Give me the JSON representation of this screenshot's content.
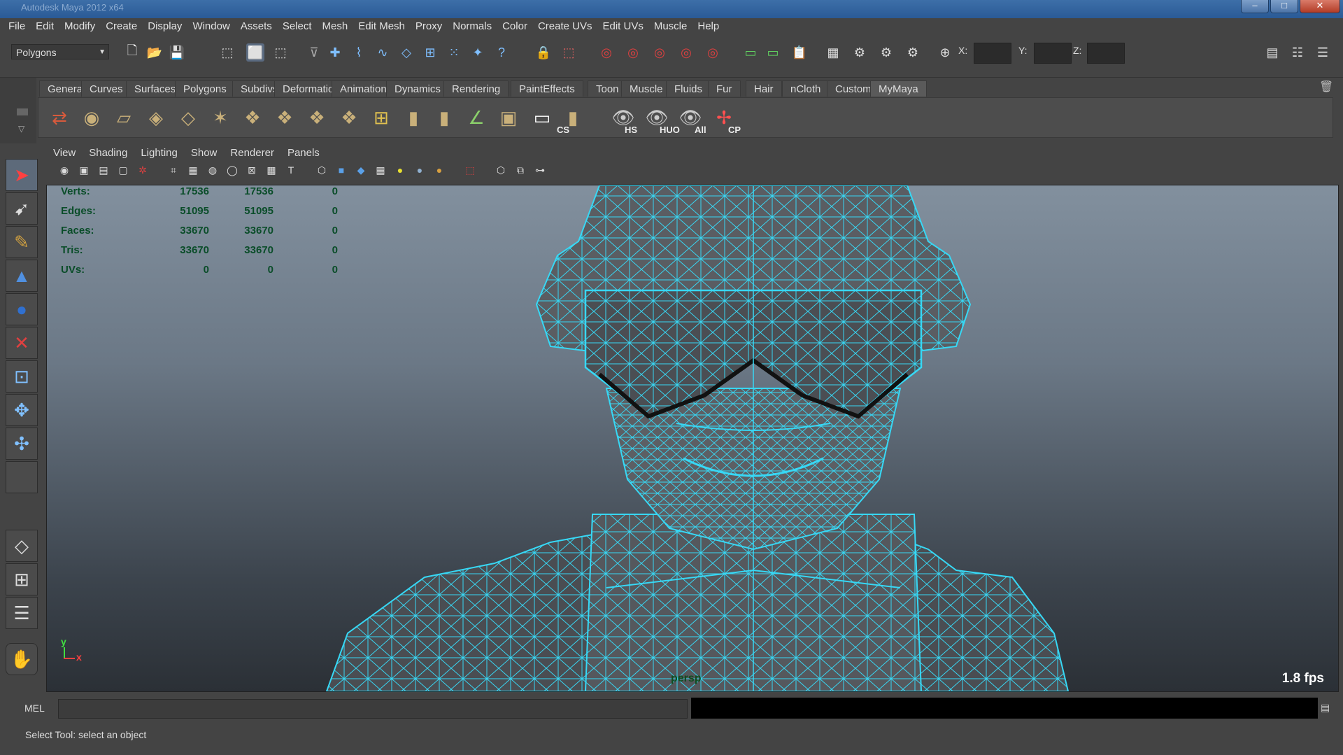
{
  "window": {
    "title": "Autodesk Maya 2012 x64"
  },
  "menus": [
    "File",
    "Edit",
    "Modify",
    "Create",
    "Display",
    "Window",
    "Assets",
    "Select",
    "Mesh",
    "Edit Mesh",
    "Proxy",
    "Normals",
    "Color",
    "Create UVs",
    "Edit UVs",
    "Muscle",
    "Help"
  ],
  "statusline": {
    "mode": "Polygons",
    "x_label": "X:",
    "y_label": "Y:",
    "z_label": "Z:"
  },
  "shelf": {
    "tabs": [
      "General",
      "Curves",
      "Surfaces",
      "Polygons",
      "Subdivs",
      "Deformation",
      "Animation",
      "Dynamics",
      "Rendering",
      "PaintEffects",
      "Toon",
      "Muscle",
      "Fluids",
      "Fur",
      "Hair",
      "nCloth",
      "Custom",
      "MyMaya"
    ],
    "active_tab": "MyMaya",
    "labeled_icons": [
      "CS",
      "HS",
      "HUO",
      "All",
      "CP"
    ]
  },
  "panel": {
    "menus": [
      "View",
      "Shading",
      "Lighting",
      "Show",
      "Renderer",
      "Panels"
    ]
  },
  "hud": {
    "rows": [
      {
        "label": "Verts:",
        "a": "17536",
        "b": "17536",
        "c": "0"
      },
      {
        "label": "Edges:",
        "a": "51095",
        "b": "51095",
        "c": "0"
      },
      {
        "label": "Faces:",
        "a": "33670",
        "b": "33670",
        "c": "0"
      },
      {
        "label": "Tris:",
        "a": "33670",
        "b": "33670",
        "c": "0"
      },
      {
        "label": "UVs:",
        "a": "0",
        "b": "0",
        "c": "0"
      }
    ],
    "camera": "persp",
    "fps": "1.8 fps",
    "axis_y": "y",
    "axis_x": "x"
  },
  "command": {
    "label": "MEL"
  },
  "help": {
    "text": "Select Tool: select an object"
  },
  "colors": {
    "wire": "#37d8f5",
    "viewport_top": "#82909e",
    "viewport_bottom": "#2b3036",
    "hud_text": "#0a4d29"
  }
}
